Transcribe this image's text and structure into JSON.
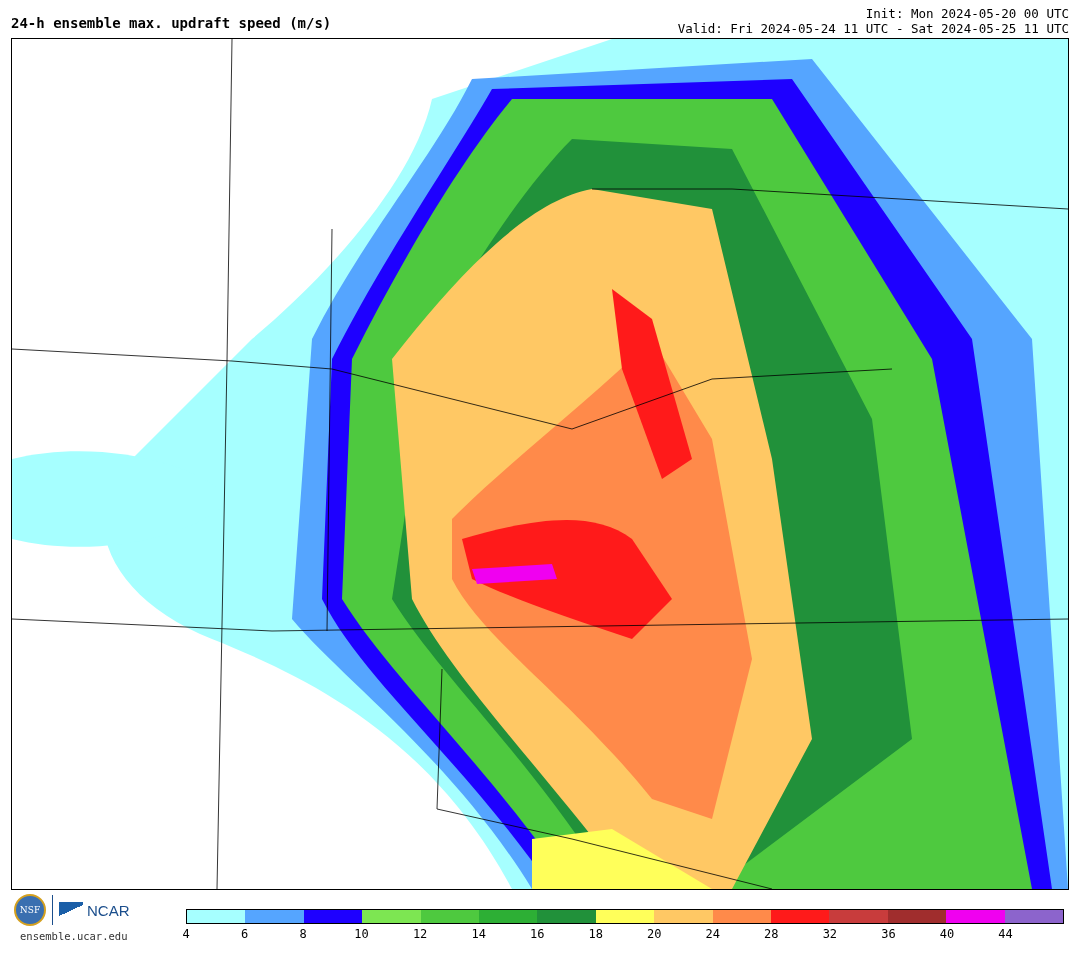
{
  "header": {
    "title": "24-h ensemble max. updraft speed (m/s)",
    "init": "Init: Mon 2024-05-20 00 UTC",
    "valid": "Valid: Fri 2024-05-24 11 UTC - Sat 2024-05-25 11 UTC"
  },
  "footer": {
    "nsf_logo": "NSF",
    "ncar_logo": "NCAR",
    "site": "ensemble.ucar.edu"
  },
  "colorbar": {
    "bins": [
      {
        "color": "#a6ffff"
      },
      {
        "color": "#55a5ff"
      },
      {
        "color": "#1e00ff"
      },
      {
        "color": "#7de652"
      },
      {
        "color": "#4ec93f"
      },
      {
        "color": "#2daf35"
      },
      {
        "color": "#21913a"
      },
      {
        "color": "#ffff5a"
      },
      {
        "color": "#ffc864"
      },
      {
        "color": "#ff8a4a"
      },
      {
        "color": "#ff1a1a"
      },
      {
        "color": "#c83c3c"
      },
      {
        "color": "#a02d2d"
      },
      {
        "color": "#f000f0"
      },
      {
        "color": "#8c64cc"
      }
    ],
    "ticks": [
      "4",
      "6",
      "8",
      "10",
      "12",
      "14",
      "16",
      "18",
      "20",
      "24",
      "28",
      "32",
      "36",
      "40",
      "44"
    ]
  }
}
